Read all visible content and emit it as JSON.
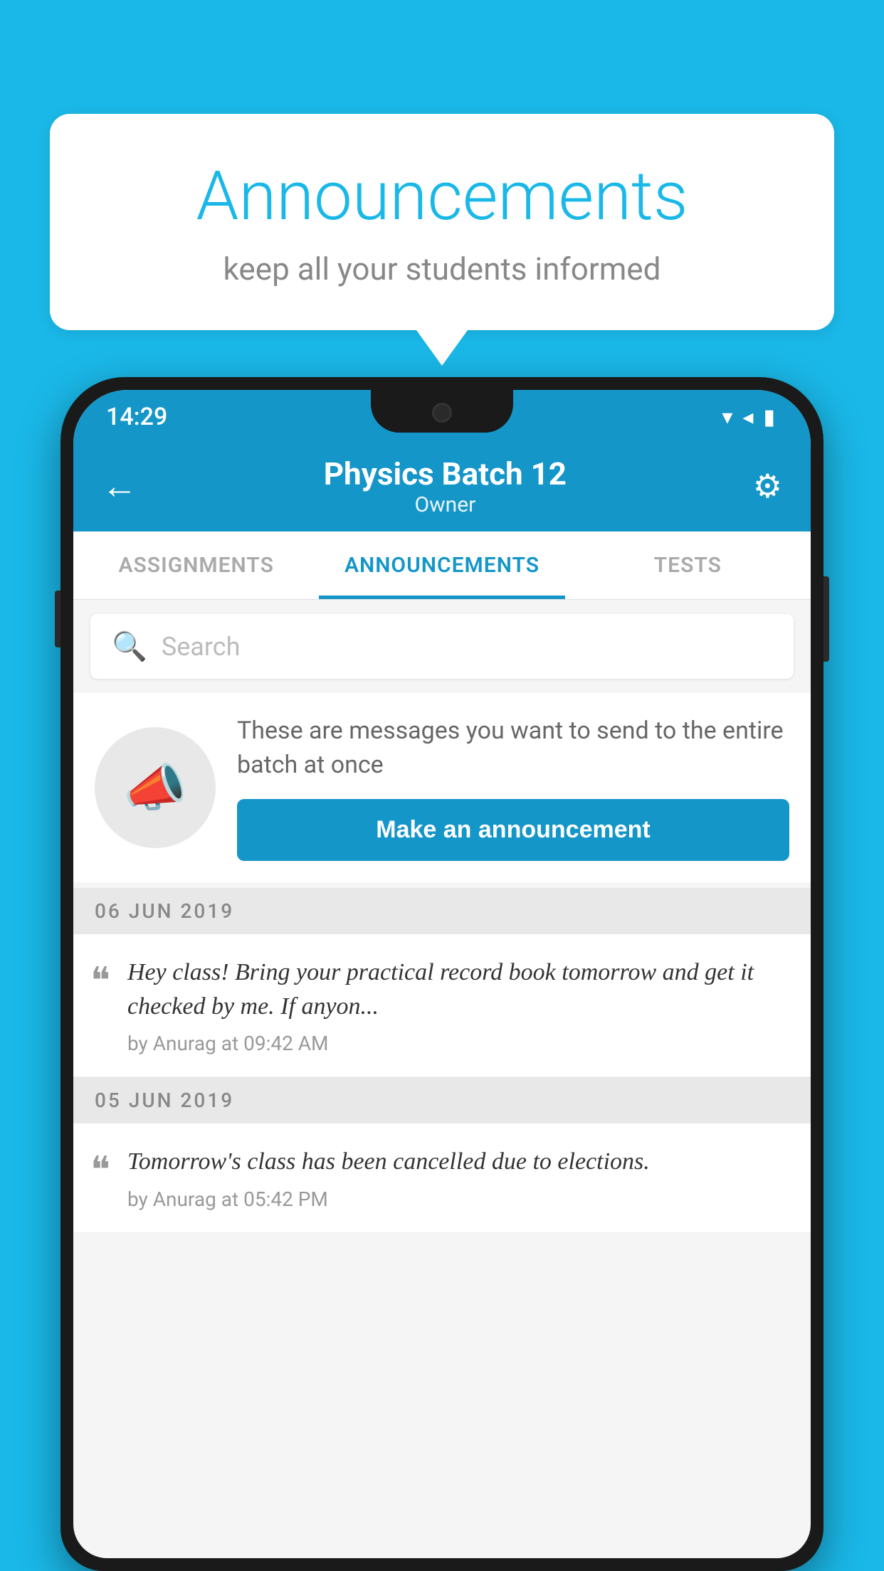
{
  "background_color": "#1ab8e8",
  "speech_bubble": {
    "title": "Announcements",
    "subtitle": "keep all your students informed"
  },
  "phone": {
    "status_bar": {
      "time": "14:29",
      "wifi": "▾",
      "signal": "▲",
      "battery": "▮"
    },
    "header": {
      "back_label": "←",
      "title": "Physics Batch 12",
      "subtitle": "Owner",
      "settings_label": "⚙"
    },
    "tabs": [
      {
        "label": "ASSIGNMENTS",
        "active": false
      },
      {
        "label": "ANNOUNCEMENTS",
        "active": true
      },
      {
        "label": "TESTS",
        "active": false
      }
    ],
    "search": {
      "placeholder": "Search"
    },
    "announcement_promo": {
      "icon": "📣",
      "description": "These are messages you want to send to the entire batch at once",
      "button_label": "Make an announcement"
    },
    "announcements": [
      {
        "date": "06  JUN  2019",
        "text": "Hey class! Bring your practical record book tomorrow and get it checked by me. If anyon...",
        "meta": "by Anurag at 09:42 AM"
      },
      {
        "date": "05  JUN  2019",
        "text": "Tomorrow's class has been cancelled due to elections.",
        "meta": "by Anurag at 05:42 PM"
      }
    ]
  }
}
